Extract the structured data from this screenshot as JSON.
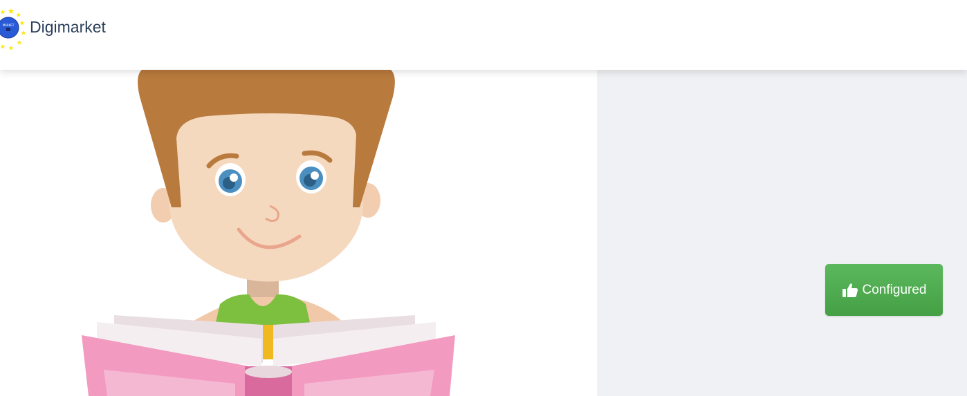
{
  "header": {
    "brand": "Digimarket",
    "logo_icon": "eu-stars-logo-icon"
  },
  "main": {
    "illustration": "boy-reading-book-illustration",
    "status_button": {
      "label": "Configured",
      "icon": "thumbs-up-icon",
      "color": "#4cae4c"
    }
  },
  "colors": {
    "brand_text": "#2c3e5a",
    "right_panel_bg": "#f0f1f4",
    "button_green": "#4cae4c"
  }
}
